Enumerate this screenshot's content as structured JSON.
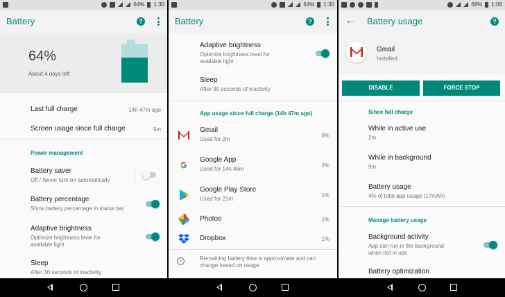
{
  "screen1": {
    "status": {
      "battery": "64%",
      "time": "1:30"
    },
    "title": "Battery",
    "summary": {
      "percent": "64%",
      "time_left": "About 4 days left",
      "level": 0.64
    },
    "rows": {
      "last_full_charge": {
        "label": "Last full charge",
        "value": "14h 47m ago"
      },
      "screen_usage": {
        "label": "Screen usage since full charge",
        "value": "9m"
      }
    },
    "section": "Power management",
    "settings": {
      "battery_saver": {
        "title": "Battery saver",
        "sub": "Off / Never turn on automatically"
      },
      "battery_percentage": {
        "title": "Battery percentage",
        "sub": "Show battery percentage in status bar"
      },
      "adaptive_brightness": {
        "title": "Adaptive brightness",
        "sub1": "Optimize brightness level for",
        "sub2": "available light"
      },
      "sleep": {
        "title": "Sleep",
        "sub": "After 30 seconds of inactivity"
      }
    }
  },
  "screen2": {
    "status": {
      "battery": "64%",
      "time": "1:30"
    },
    "title": "Battery",
    "adaptive_brightness": {
      "title": "Adaptive brightness",
      "sub1": "Optimize brightness level for",
      "sub2": "available light"
    },
    "sleep": {
      "title": "Sleep",
      "sub": "After 30 seconds of inactivity"
    },
    "section": "App usage since full charge (14h 47m ago)",
    "apps": [
      {
        "name": "Gmail",
        "sub": "Used for 2m",
        "percent": "6%",
        "icon": "gmail-icon"
      },
      {
        "name": "Google App",
        "sub": "Used for 14h 46m",
        "percent": "2%",
        "icon": "google-icon"
      },
      {
        "name": "Google Play Store",
        "sub": "Used for 21m",
        "percent": "1%",
        "icon": "play-store-icon"
      },
      {
        "name": "Photos",
        "sub": "",
        "percent": "1%",
        "icon": "photos-icon"
      },
      {
        "name": "Dropbox",
        "sub": "",
        "percent": "1%",
        "icon": "dropbox-icon"
      }
    ],
    "footer": {
      "line1": "Remaining battery time is approximate and can",
      "line2": "change based on usage"
    }
  },
  "screen3": {
    "status": {
      "battery": "68%",
      "time": "1:06"
    },
    "title": "Battery usage",
    "app": {
      "name": "Gmail",
      "status": "Installed"
    },
    "buttons": {
      "disable": "DISABLE",
      "force_stop": "FORCE STOP"
    },
    "section1": "Since full charge",
    "active_use": {
      "title": "While in active use",
      "value": "2m"
    },
    "background": {
      "title": "While in background",
      "value": "9m"
    },
    "battery_usage": {
      "title": "Battery usage",
      "value": "4% of total app usage (17mAh)"
    },
    "section2": "Manage battery usage",
    "bg_activity": {
      "title": "Background activity",
      "sub1": "App can run in the background",
      "sub2": "when not in use"
    },
    "optimization": {
      "title": "Battery optimization"
    }
  },
  "colors": {
    "accent": "#00897b",
    "accent_light": "#80cbc4",
    "battery_fill": "#00897b",
    "battery_empty": "#b2dfdb"
  }
}
